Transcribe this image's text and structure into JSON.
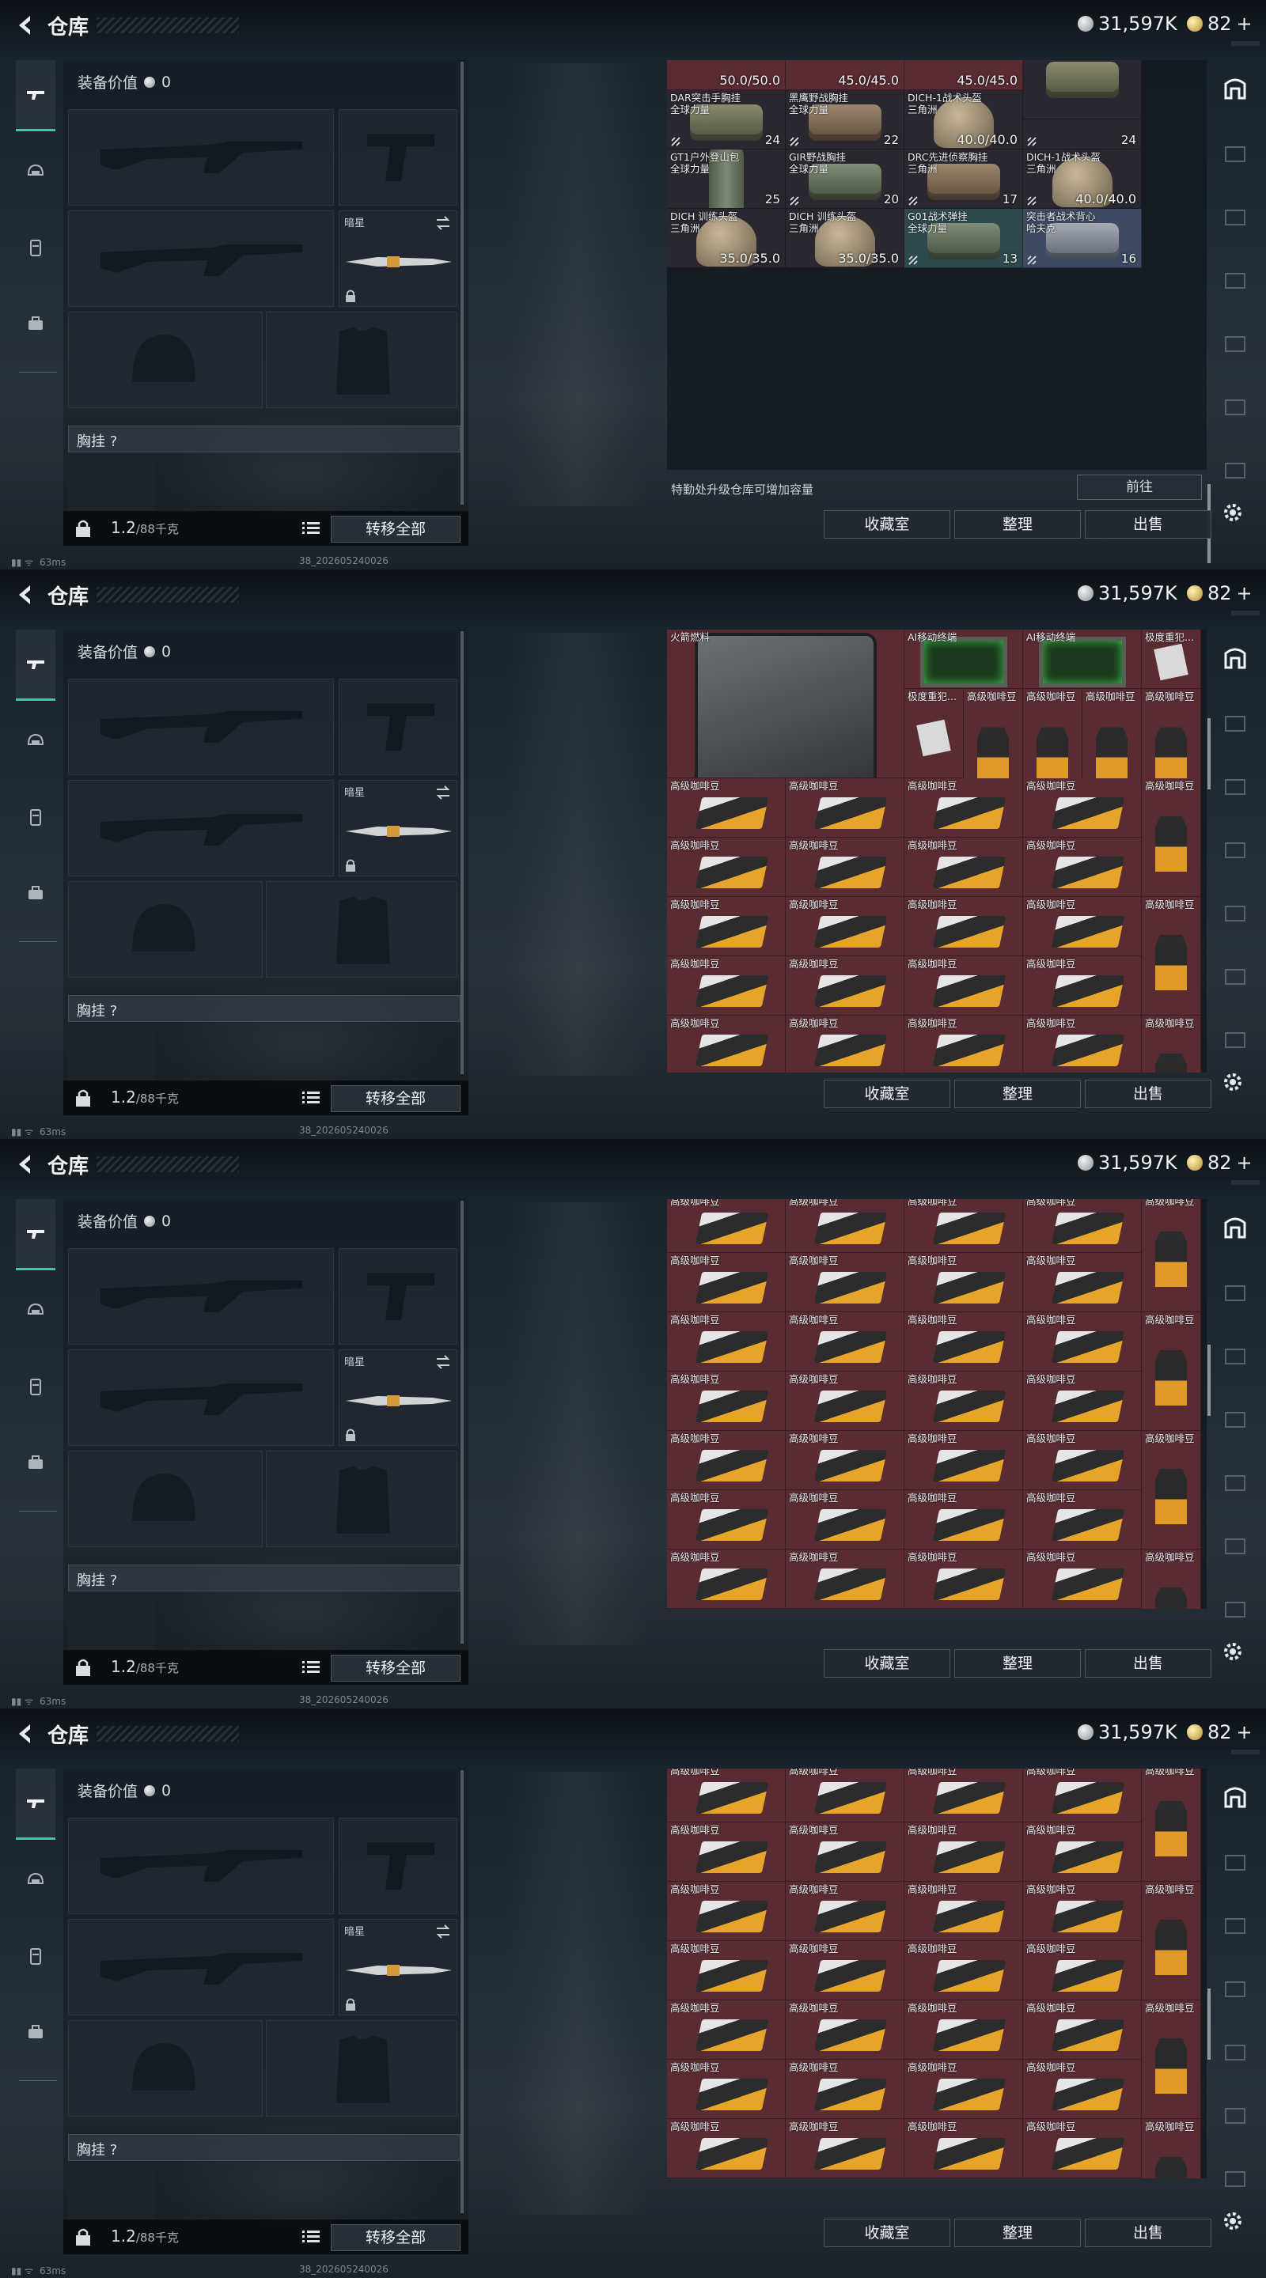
{
  "header": {
    "title": "仓库",
    "currency_silver": "31,597K",
    "currency_gold": "82",
    "gold_plus": "+"
  },
  "loadout": {
    "value_label": "装备价值",
    "value": "0",
    "melee_label": "暗星",
    "rig_label": "胸挂 ?",
    "weight_value": "1.2",
    "weight_max": "/88千克",
    "transfer_all": "转移全部"
  },
  "stash": {
    "upgrade_text": "特勤处升级仓库可增加容量",
    "go_label": "前往",
    "collection_label": "收藏室",
    "organize_label": "整理",
    "sell_label": "出售"
  },
  "status": {
    "ping": "63ms",
    "build": "38_202605240026"
  },
  "screen1": {
    "items": [
      {
        "name": "",
        "value": "50.0/50.0"
      },
      {
        "name": "",
        "value": "45.0/45.0"
      },
      {
        "name": "",
        "value": "45.0/45.0"
      },
      {
        "name": "DAR突击手胸挂\n全球力量",
        "value": ""
      },
      {
        "name": "DAR突击手胸挂\n全球力量",
        "value": "24"
      },
      {
        "name": "黑鹰野战胸挂\n全球力量",
        "value": "22"
      },
      {
        "name": "DICH-1战术头盔\n三角洲",
        "value": "40.0/40.0"
      },
      {
        "name": "",
        "value": "24"
      },
      {
        "name": "DICH-1战术头盔\n三角洲",
        "value": "40.0/40.0"
      },
      {
        "name": "GT1户外登山包\n全球力量",
        "value": "25"
      },
      {
        "name": "GIR野战胸挂\n全球力量",
        "value": "20"
      },
      {
        "name": "DRC先进侦察胸挂\n三角洲",
        "value": "17"
      },
      {
        "name": "突击者战术背心\n哈夫克",
        "value": "16"
      },
      {
        "name": "DICH 训练头盔\n三角洲",
        "value": "35.0/35.0"
      },
      {
        "name": "DICH 训练头盔\n三角洲",
        "value": "35.0/35.0"
      },
      {
        "name": "G01战术弹挂\n全球力量",
        "value": "13"
      }
    ]
  },
  "screen2": {
    "items": [
      {
        "name": "火箭燃料"
      },
      {
        "name": "AI移动终端"
      },
      {
        "name": "AI移动终端"
      },
      {
        "name": "极度重犯..."
      },
      {
        "name": "极度重犯..."
      },
      {
        "name": "高级咖啡豆"
      }
    ]
  },
  "coffee": {
    "name": "高级咖啡豆"
  }
}
